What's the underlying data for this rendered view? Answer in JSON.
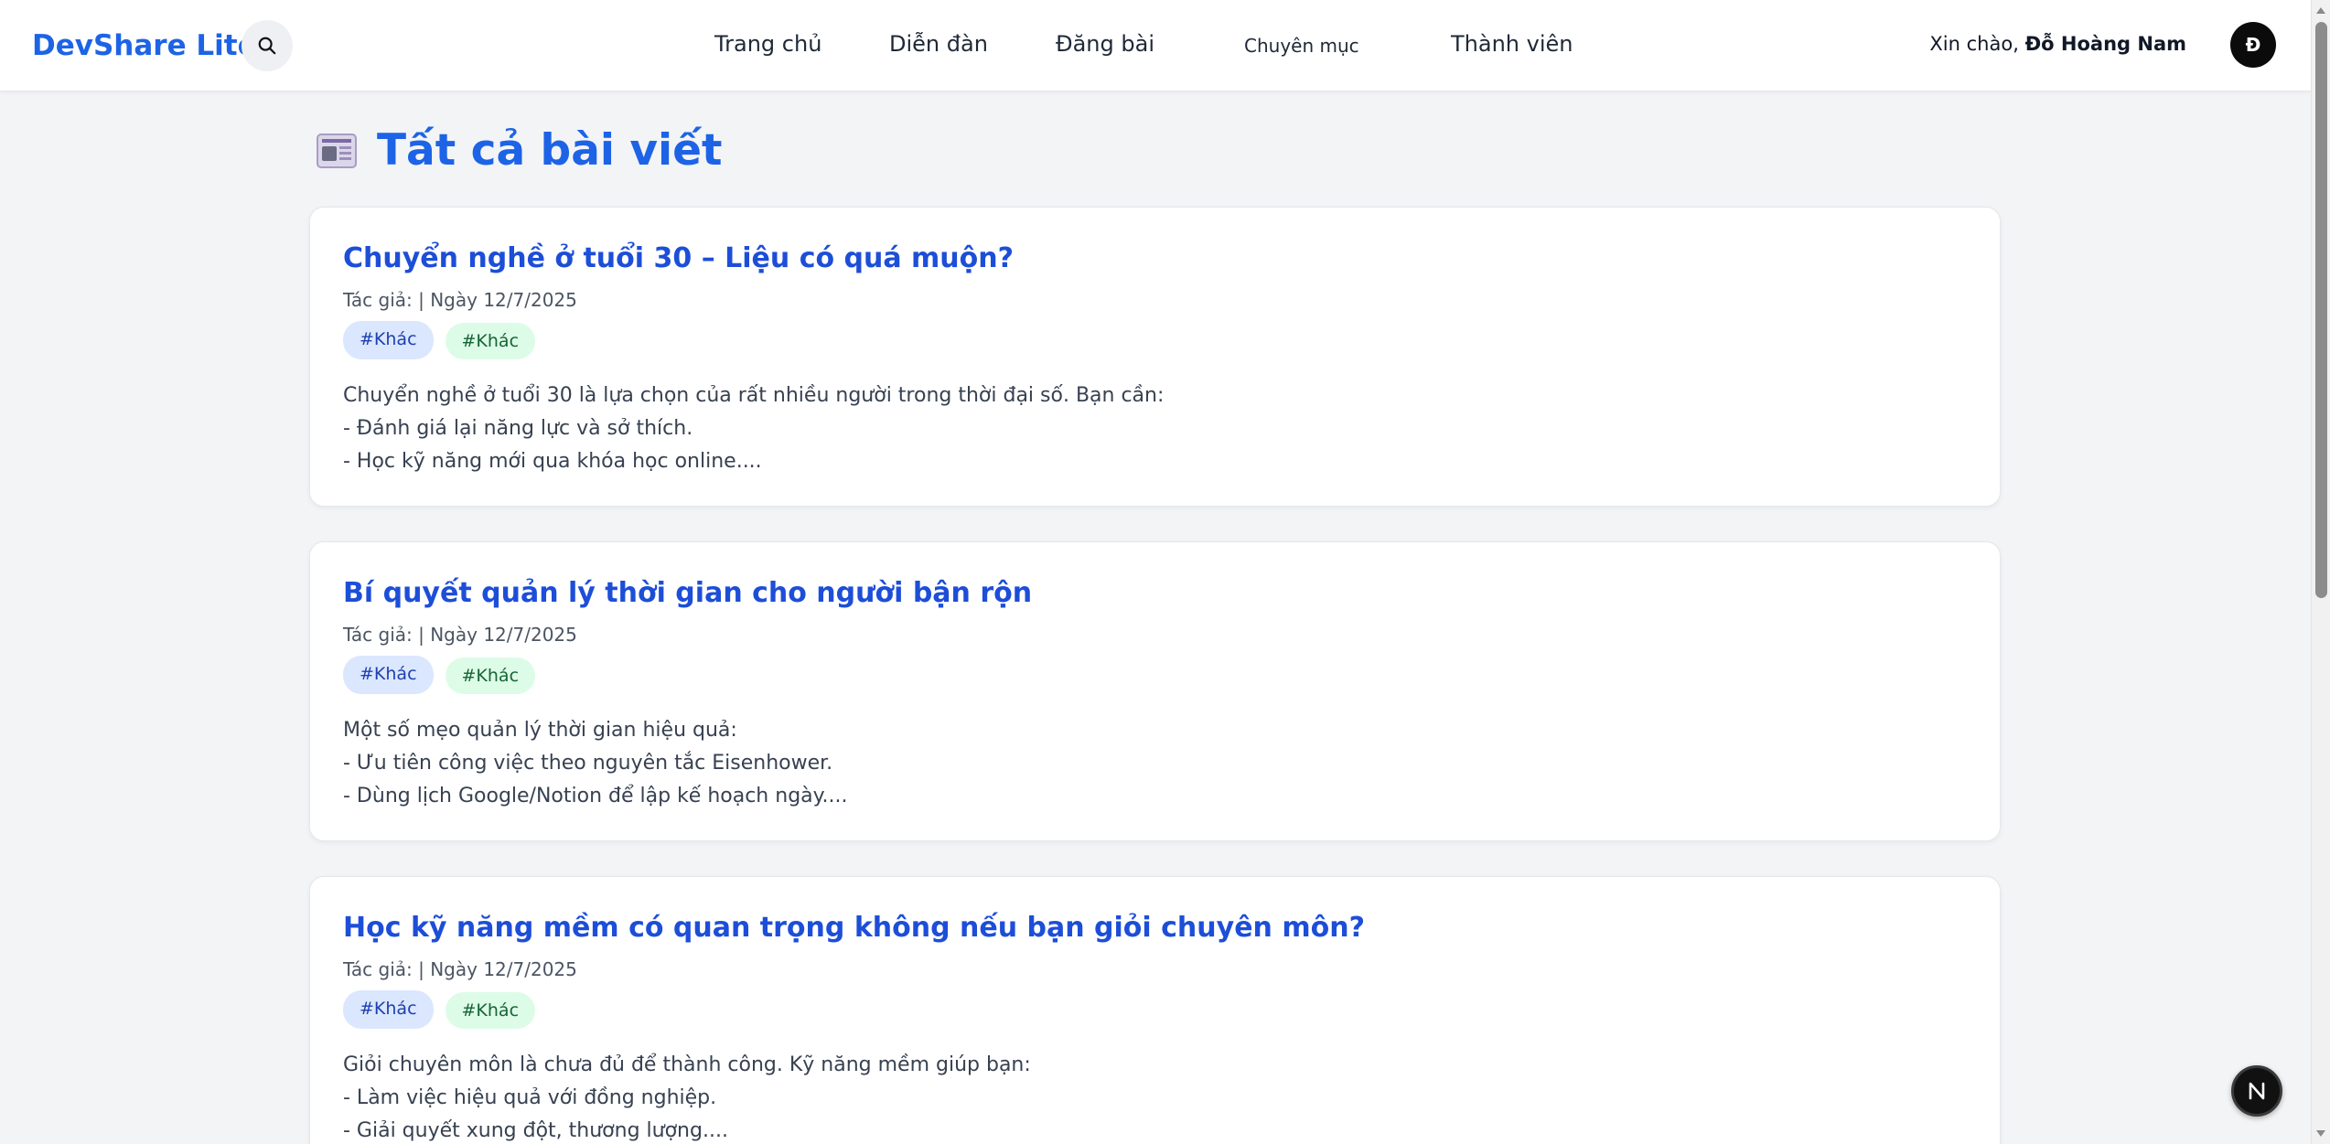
{
  "header": {
    "brand": "DevShare Lite",
    "nav": [
      {
        "label": "Trang chủ"
      },
      {
        "label": "Diễn đàn"
      },
      {
        "label": "Đăng bài"
      },
      {
        "label": "Chuyên mục"
      },
      {
        "label": "Thành viên"
      }
    ],
    "greeting_prefix": "Xin chào,",
    "user_name": "Đỗ Hoàng Nam",
    "avatar_initial": "Đ"
  },
  "page": {
    "title": "Tất cả bài viết"
  },
  "posts": [
    {
      "title": "Chuyển nghề ở tuổi 30 – Liệu có quá muộn?",
      "meta": "Tác giả: | Ngày 12/7/2025",
      "tags": [
        "#Khác",
        "#Khác"
      ],
      "excerpt": "Chuyển nghề ở tuổi 30 là lựa chọn của rất nhiều người trong thời đại số. Bạn cần:\n- Đánh giá lại năng lực và sở thích.\n- Học kỹ năng mới qua khóa học online...."
    },
    {
      "title": "Bí quyết quản lý thời gian cho người bận rộn",
      "meta": "Tác giả: | Ngày 12/7/2025",
      "tags": [
        "#Khác",
        "#Khác"
      ],
      "excerpt": "Một số mẹo quản lý thời gian hiệu quả:\n- Ưu tiên công việc theo nguyên tắc Eisenhower.\n- Dùng lịch Google/Notion để lập kế hoạch ngày...."
    },
    {
      "title": "Học kỹ năng mềm có quan trọng không nếu bạn giỏi chuyên môn?",
      "meta": "Tác giả: | Ngày 12/7/2025",
      "tags": [
        "#Khác",
        "#Khác"
      ],
      "excerpt": "Giỏi chuyên môn là chưa đủ để thành công. Kỹ năng mềm giúp bạn:\n- Làm việc hiệu quả với đồng nghiệp.\n- Giải quyết xung đột, thương lượng...."
    }
  ],
  "badge": {
    "letter": "N"
  },
  "icons": {
    "search": "search-icon",
    "news": "newspaper-icon",
    "badge": "n-logo-icon"
  },
  "colors": {
    "accent": "#1d63e6",
    "tag_blue_bg": "#dbe7fe",
    "tag_green_bg": "#dcfce7"
  }
}
